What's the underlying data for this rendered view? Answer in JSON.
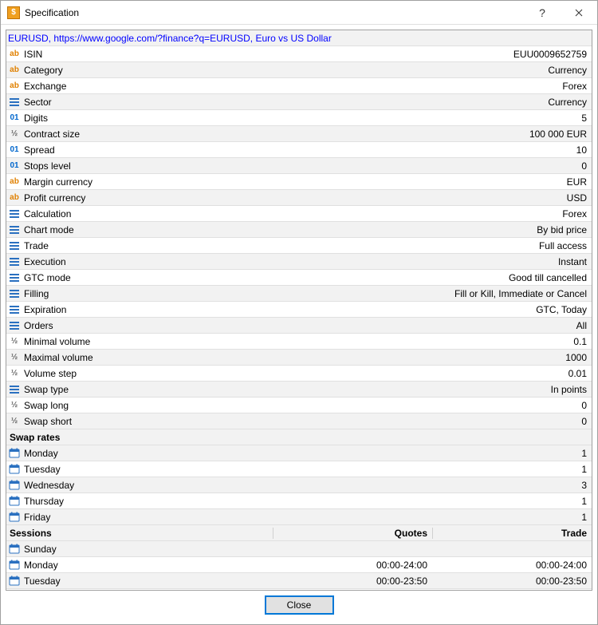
{
  "window": {
    "title": "Specification",
    "help_tooltip": "?",
    "close_tooltip": "Close"
  },
  "instrument": "EURUSD, https://www.google.com/?finance?q=EURUSD, Euro vs US Dollar",
  "props": [
    {
      "icon": "ab",
      "label": "ISIN",
      "value": "EUU0009652759"
    },
    {
      "icon": "ab",
      "label": "Category",
      "value": "Currency"
    },
    {
      "icon": "ab",
      "label": "Exchange",
      "value": "Forex"
    },
    {
      "icon": "list",
      "label": "Sector",
      "value": "Currency"
    },
    {
      "icon": "01",
      "label": "Digits",
      "value": "5"
    },
    {
      "icon": "half",
      "label": "Contract size",
      "value": "100 000 EUR"
    },
    {
      "icon": "01",
      "label": "Spread",
      "value": "10"
    },
    {
      "icon": "01",
      "label": "Stops level",
      "value": "0"
    },
    {
      "icon": "ab",
      "label": "Margin currency",
      "value": "EUR"
    },
    {
      "icon": "ab",
      "label": "Profit currency",
      "value": "USD"
    },
    {
      "icon": "list",
      "label": "Calculation",
      "value": "Forex"
    },
    {
      "icon": "list",
      "label": "Chart mode",
      "value": "By bid price"
    },
    {
      "icon": "list",
      "label": "Trade",
      "value": "Full access"
    },
    {
      "icon": "list",
      "label": "Execution",
      "value": "Instant"
    },
    {
      "icon": "list",
      "label": "GTC mode",
      "value": "Good till cancelled"
    },
    {
      "icon": "list",
      "label": "Filling",
      "value": "Fill or Kill, Immediate or Cancel"
    },
    {
      "icon": "list",
      "label": "Expiration",
      "value": "GTC, Today"
    },
    {
      "icon": "list",
      "label": "Orders",
      "value": "All"
    },
    {
      "icon": "half",
      "label": "Minimal volume",
      "value": "0.1"
    },
    {
      "icon": "half",
      "label": "Maximal volume",
      "value": "1000"
    },
    {
      "icon": "half",
      "label": "Volume step",
      "value": "0.01"
    },
    {
      "icon": "list",
      "label": "Swap type",
      "value": "In points"
    },
    {
      "icon": "half",
      "label": "Swap long",
      "value": "0"
    },
    {
      "icon": "half",
      "label": "Swap short",
      "value": "0"
    }
  ],
  "swap_section": "Swap rates",
  "swap_days": [
    {
      "label": "Monday",
      "value": "1"
    },
    {
      "label": "Tuesday",
      "value": "1"
    },
    {
      "label": "Wednesday",
      "value": "3"
    },
    {
      "label": "Thursday",
      "value": "1"
    },
    {
      "label": "Friday",
      "value": "1"
    }
  ],
  "sessions_section": "Sessions",
  "sessions_header": {
    "quotes": "Quotes",
    "trade": "Trade"
  },
  "sessions": [
    {
      "label": "Sunday",
      "quotes": "",
      "trade": ""
    },
    {
      "label": "Monday",
      "quotes": "00:00-24:00",
      "trade": "00:00-24:00"
    },
    {
      "label": "Tuesday",
      "quotes": "00:00-23:50",
      "trade": "00:00-23:50"
    }
  ],
  "footer": {
    "close_label": "Close"
  }
}
